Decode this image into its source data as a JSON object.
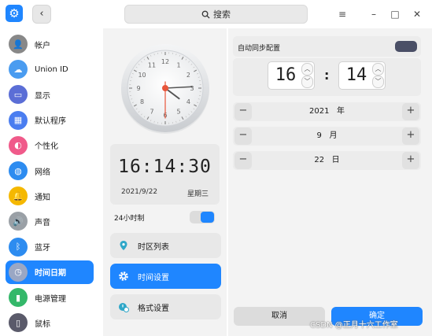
{
  "titlebar": {
    "search_label": "搜索"
  },
  "sidebar": {
    "items": [
      {
        "label": "帐户",
        "icon": "account-icon",
        "color": "#888888"
      },
      {
        "label": "Union ID",
        "icon": "cloud-icon",
        "color": "#4a9cf0"
      },
      {
        "label": "显示",
        "icon": "display-icon",
        "color": "#5b6ed6"
      },
      {
        "label": "默认程序",
        "icon": "default-apps-icon",
        "color": "#4a7df0"
      },
      {
        "label": "个性化",
        "icon": "personalization-icon",
        "color": "#f05a8a"
      },
      {
        "label": "网络",
        "icon": "network-icon",
        "color": "#2d8cf0"
      },
      {
        "label": "通知",
        "icon": "bell-icon",
        "color": "#f5b800"
      },
      {
        "label": "声音",
        "icon": "speaker-icon",
        "color": "#9aa0a6"
      },
      {
        "label": "蓝牙",
        "icon": "bluetooth-icon",
        "color": "#2d8cf0"
      },
      {
        "label": "时间日期",
        "icon": "clock-icon",
        "color": "#9aa7c4",
        "active": true
      },
      {
        "label": "电源管理",
        "icon": "power-icon",
        "color": "#34b86a"
      },
      {
        "label": "鼠标",
        "icon": "mouse-icon",
        "color": "#5a5a6a"
      }
    ]
  },
  "clock": {
    "digital_time": "16:14:30",
    "date": "2021/9/22",
    "weekday": "星期三",
    "hour": 16,
    "minute": 14,
    "second": 30,
    "hour24_label": "24小时制",
    "hour24_enabled": true
  },
  "menu": [
    {
      "label": "时区列表",
      "icon": "timezone-icon",
      "active": false
    },
    {
      "label": "时间设置",
      "icon": "gear-icon",
      "active": true
    },
    {
      "label": "格式设置",
      "icon": "format-icon",
      "active": false
    }
  ],
  "settings": {
    "auto_sync_label": "自动同步配置",
    "auto_sync_enabled": true,
    "hour": "16",
    "minute": "14",
    "year_value": "2021",
    "year_unit": "年",
    "month_value": "9",
    "month_unit": "月",
    "day_value": "22",
    "day_unit": "日",
    "cancel_label": "取消",
    "confirm_label": "确定"
  },
  "colors": {
    "accent": "#1f86ff",
    "toggle_dark": "#4a4f66"
  },
  "watermark": "CSDN @正月十六工作室"
}
